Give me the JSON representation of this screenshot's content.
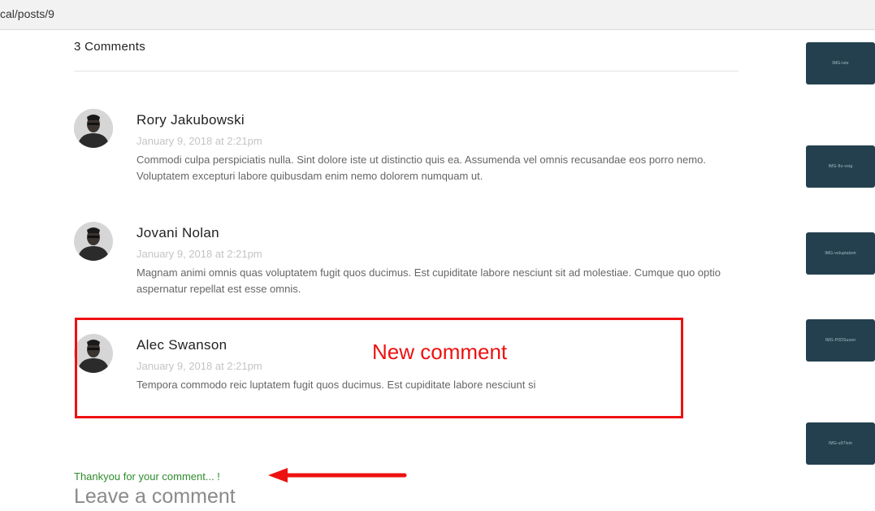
{
  "address_bar": {
    "url": "cal/posts/9"
  },
  "comments_section": {
    "title": "3 Comments",
    "comments": [
      {
        "author": "Rory Jakubowski",
        "date": "January 9, 2018 at 2:21pm",
        "body": "Commodi culpa perspiciatis nulla. Sint dolore iste ut distinctio quis ea. Assumenda vel omnis recusandae eos porro nemo. Voluptatem excepturi labore quibusdam enim nemo dolorem numquam ut."
      },
      {
        "author": "Jovani Nolan",
        "date": "January 9, 2018 at 2:21pm",
        "body": "Magnam animi omnis quas voluptatem fugit quos ducimus. Est cupiditate labore nesciunt sit ad molestiae. Cumque quo optio aspernatur repellat est esse omnis."
      },
      {
        "author": "Alec Swanson",
        "date": "January 9, 2018 at 2:21pm",
        "body": "Tempora commodo reic luptatem fugit quos ducimus. Est cupiditate labore nesciunt si"
      }
    ]
  },
  "annotation": {
    "label": "New comment",
    "color": "#ee1111"
  },
  "confirmation": {
    "message": "Thankyou for your comment... !"
  },
  "leave_comment": {
    "heading": "Leave a comment"
  },
  "sidebar": {
    "cards": [
      {
        "label": "IMG-iste"
      },
      {
        "label": "IMG-flo-voig"
      },
      {
        "label": "IMG-voluptatem"
      },
      {
        "label": "IMG-P0DSusen"
      },
      {
        "label": "IMG-u97ism"
      }
    ]
  },
  "colors": {
    "card_background": "#24404f",
    "confirmation_text": "#2e8b2e",
    "date_text": "#c4c4c4"
  }
}
